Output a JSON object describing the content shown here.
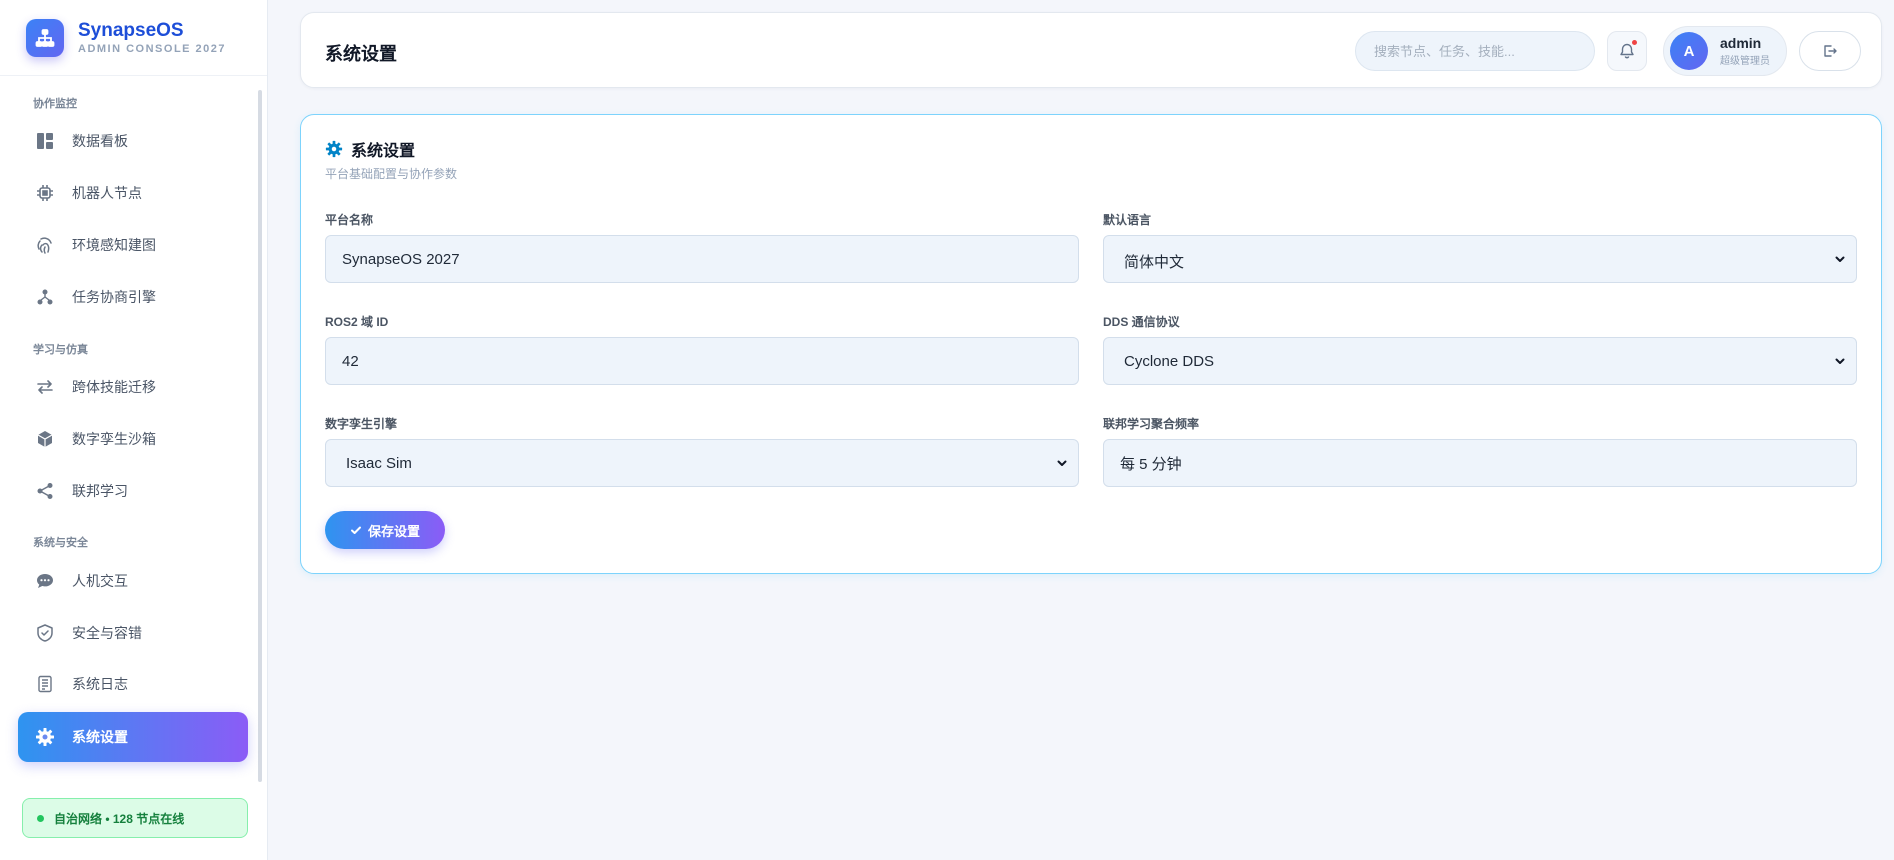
{
  "brand": {
    "name": "SynapseOS",
    "subtitle": "ADMIN CONSOLE 2027"
  },
  "sidebar": {
    "sections": [
      {
        "label": "协作监控"
      },
      {
        "label": "学习与仿真"
      },
      {
        "label": "系统与安全"
      }
    ],
    "items": [
      {
        "label": "数据看板",
        "icon": "dashboard-icon"
      },
      {
        "label": "机器人节点",
        "icon": "chip-icon"
      },
      {
        "label": "环境感知建图",
        "icon": "fingerprint-icon"
      },
      {
        "label": "任务协商引擎",
        "icon": "sitemap-icon"
      },
      {
        "label": "跨体技能迁移",
        "icon": "exchange-icon"
      },
      {
        "label": "数字孪生沙箱",
        "icon": "cube-icon"
      },
      {
        "label": "联邦学习",
        "icon": "share-icon"
      },
      {
        "label": "人机交互",
        "icon": "chat-icon"
      },
      {
        "label": "安全与容错",
        "icon": "shield-icon"
      },
      {
        "label": "系统日志",
        "icon": "log-icon"
      },
      {
        "label": "系统设置",
        "icon": "gear-icon",
        "active": true
      }
    ],
    "status": {
      "text": "自治网络 • 128 节点在线",
      "color": "#22c55e"
    }
  },
  "header": {
    "title": "系统设置",
    "search_placeholder": "搜索节点、任务、技能...",
    "user": {
      "avatar": "A",
      "name": "admin",
      "role": "超级管理员"
    }
  },
  "settings": {
    "title": "系统设置",
    "subtitle": "平台基础配置与协作参数",
    "fields": {
      "platform_name": {
        "label": "平台名称",
        "value": "SynapseOS 2027"
      },
      "default_language": {
        "label": "默认语言",
        "value": "简体中文"
      },
      "ros2_domain": {
        "label": "ROS2 域 ID",
        "value": "42"
      },
      "dds_protocol": {
        "label": "DDS 通信协议",
        "value": "Cyclone DDS"
      },
      "twin_engine": {
        "label": "数字孪生引擎",
        "value": "Isaac Sim"
      },
      "fl_frequency": {
        "label": "联邦学习聚合频率",
        "value": "每 5 分钟"
      }
    },
    "save_label": "保存设置"
  },
  "colors": {
    "accent": "#3b82f6",
    "accent_end": "#8b5cf6",
    "card_border": "#7dd3fc"
  }
}
